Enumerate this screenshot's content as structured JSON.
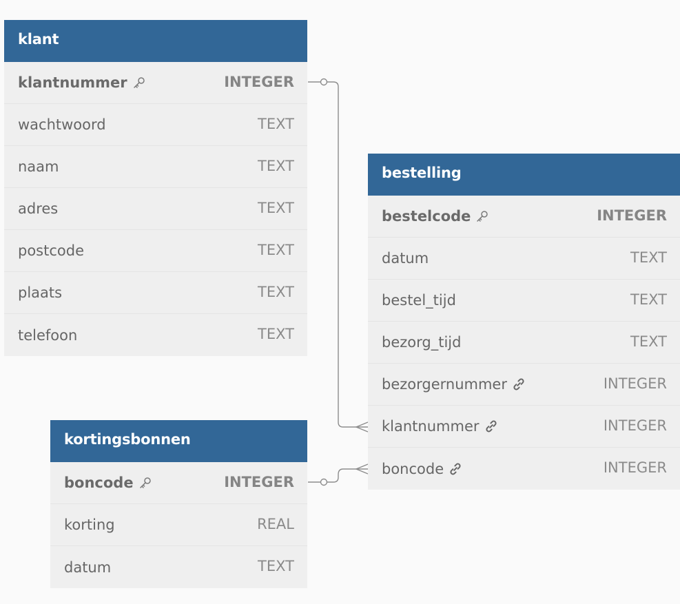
{
  "tables": {
    "klant": {
      "title": "klant",
      "columns": [
        {
          "name": "klantnummer",
          "type": "INTEGER",
          "icon": "key-icon"
        },
        {
          "name": "wachtwoord",
          "type": "TEXT"
        },
        {
          "name": "naam",
          "type": "TEXT"
        },
        {
          "name": "adres",
          "type": "TEXT"
        },
        {
          "name": "postcode",
          "type": "TEXT"
        },
        {
          "name": "plaats",
          "type": "TEXT"
        },
        {
          "name": "telefoon",
          "type": "TEXT"
        }
      ]
    },
    "bestelling": {
      "title": "bestelling",
      "columns": [
        {
          "name": "bestelcode",
          "type": "INTEGER",
          "icon": "key-icon"
        },
        {
          "name": "datum",
          "type": "TEXT"
        },
        {
          "name": "bestel_tijd",
          "type": "TEXT"
        },
        {
          "name": "bezorg_tijd",
          "type": "TEXT"
        },
        {
          "name": "bezorgernummer",
          "type": "INTEGER",
          "icon": "link-icon"
        },
        {
          "name": "klantnummer",
          "type": "INTEGER",
          "icon": "link-icon"
        },
        {
          "name": "boncode",
          "type": "INTEGER",
          "icon": "link-icon"
        }
      ]
    },
    "kortingsbonnen": {
      "title": "kortingsbonnen",
      "columns": [
        {
          "name": "boncode",
          "type": "INTEGER",
          "icon": "key-icon"
        },
        {
          "name": "korting",
          "type": "REAL"
        },
        {
          "name": "datum",
          "type": "TEXT"
        }
      ]
    }
  },
  "relationships": [
    {
      "from": "klant.klantnummer",
      "to": "bestelling.klantnummer",
      "cardinality": "one-to-many"
    },
    {
      "from": "kortingsbonnen.boncode",
      "to": "bestelling.boncode",
      "cardinality": "one-to-many"
    }
  ],
  "colors": {
    "header": "#326797",
    "body": "#efefef",
    "background": "#fafafa",
    "connector": "#8c8c8c"
  }
}
